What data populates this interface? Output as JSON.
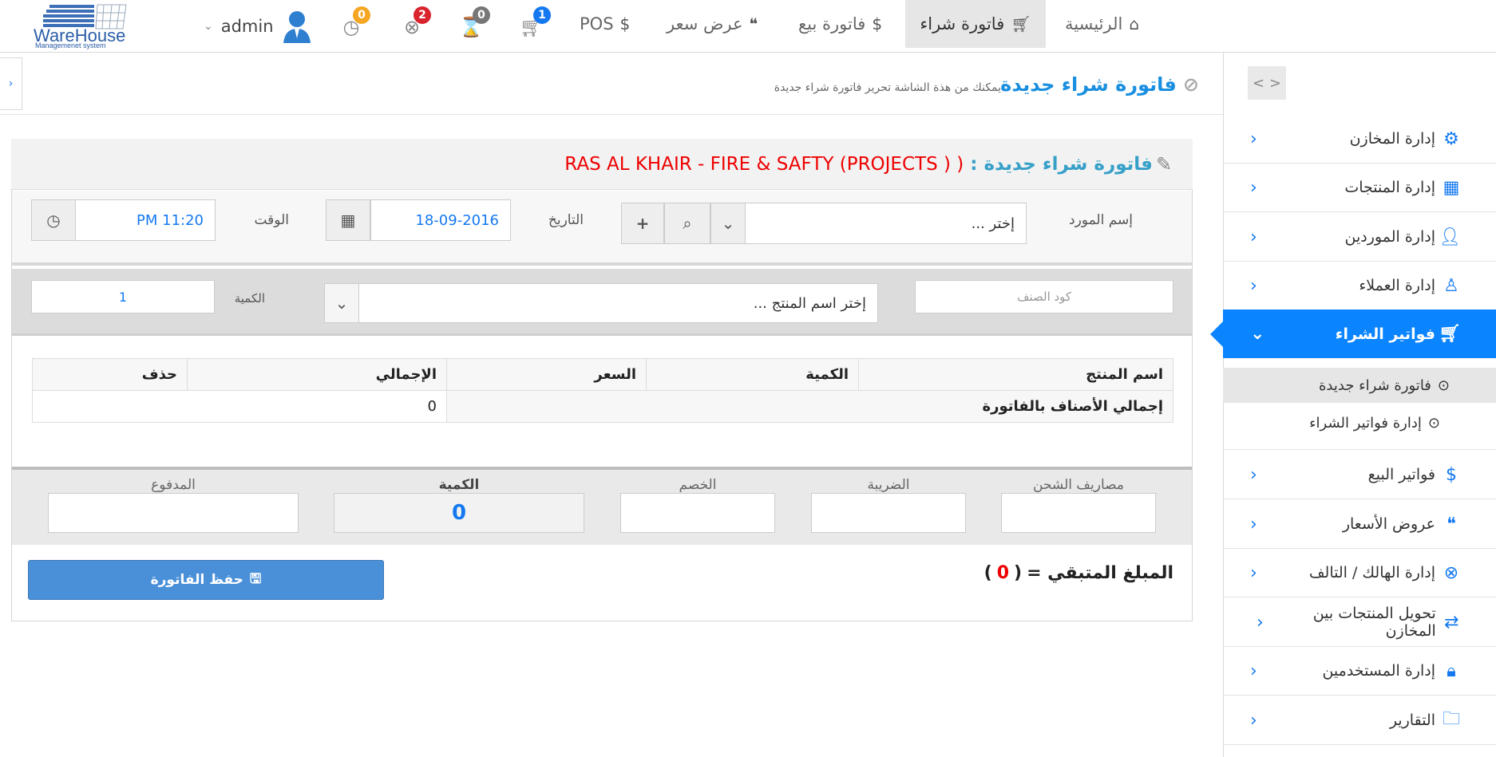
{
  "logo": {
    "line1": "WareHouse",
    "line2": "Managemenet system"
  },
  "topnav": {
    "home": "الرئيسية",
    "purchase_invoice": "فاتورة شراء",
    "sales_invoice": "فاتورة بيع",
    "quote": "عرض سعر",
    "pos": "POS"
  },
  "top_icons": {
    "cart_badge": "1",
    "hourglass_badge": "0",
    "cancel_badge": "2",
    "clock_badge": "0"
  },
  "user": {
    "name": "admin"
  },
  "sidebar": {
    "toggle": "< >",
    "items": [
      {
        "label": "إدارة المخازن",
        "icon": "gear-icon"
      },
      {
        "label": "إدارة المنتجات",
        "icon": "grid-icon"
      },
      {
        "label": "إدارة الموردين",
        "icon": "person-icon"
      },
      {
        "label": "إدارة العملاء",
        "icon": "user-outline-icon"
      },
      {
        "label": "فواتير الشراء",
        "icon": "cart-icon"
      },
      {
        "label": "فواتير البيع",
        "icon": "dollar-icon"
      },
      {
        "label": "عروض الأسعار",
        "icon": "quote-icon"
      },
      {
        "label": "إدارة الهالك / التالف",
        "icon": "x-circle-icon"
      },
      {
        "label": "تحويل المنتجات بين المخازن",
        "icon": "transfer-icon"
      },
      {
        "label": "إدارة المستخدمين",
        "icon": "lock-icon"
      },
      {
        "label": "التقارير",
        "icon": "folder-icon"
      }
    ],
    "submenu": [
      {
        "label": "فاتورة شراء جديدة"
      },
      {
        "label": "إدارة فواتير الشراء"
      }
    ]
  },
  "page": {
    "title": "فاتورة شراء جديدة",
    "subtitle": "يمكنك من هذة الشاشة تحرير فاتورة شراء جديدة"
  },
  "panel": {
    "title_prefix": "فاتورة شراء جديدة :",
    "title_supplier": "( RAS AL KHAIR - FIRE & SAFTY (PROJECTS )"
  },
  "form": {
    "supplier_label": "إسم المورد",
    "supplier_value": "إختر ...",
    "date_label": "التاريخ",
    "date_value": "18-09-2016",
    "time_label": "الوقت",
    "time_value": "11:20 PM",
    "item_code_placeholder": "كود الصنف",
    "product_value": "إختر اسم المنتج ...",
    "qty_label": "الكمية",
    "qty_value": "1"
  },
  "table": {
    "headers": [
      "اسم المنتج",
      "الكمية",
      "السعر",
      "الإجمالي",
      "حذف"
    ],
    "total_label": "إجمالي الأصناف بالفاتورة",
    "total_value": "0"
  },
  "totals": {
    "shipping": "مصاريف الشحن",
    "tax": "الضريبة",
    "discount": "الخصم",
    "quantity": "الكمية",
    "quantity_value": "0",
    "paid": "المدفوع"
  },
  "footer": {
    "remaining_label": "المبلغ المتبقي =",
    "remaining_open": "(",
    "remaining_value": "0",
    "remaining_close": ")",
    "save_label": "حفظ الفاتورة"
  },
  "colors": {
    "accent": "#0a84ff",
    "title": "#1a8fe0",
    "alert": "#ee0000"
  }
}
